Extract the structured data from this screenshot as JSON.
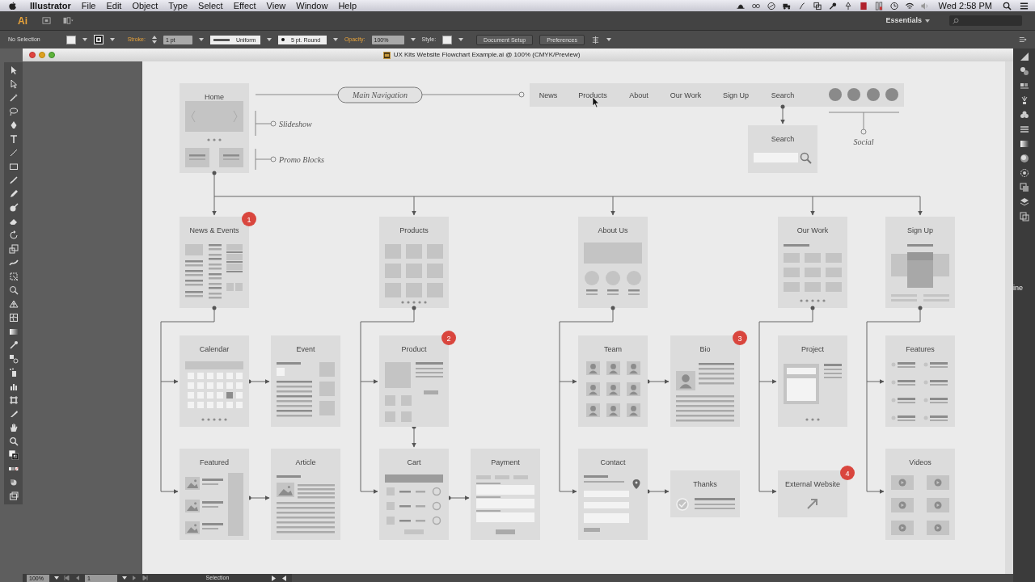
{
  "menu_bar": {
    "app_name": "Illustrator",
    "menus": [
      "File",
      "Edit",
      "Object",
      "Type",
      "Select",
      "Effect",
      "View",
      "Window",
      "Help"
    ],
    "clock": "Wed 2:58 PM"
  },
  "app_bar": {
    "logo": "Ai",
    "workspace": "Essentials"
  },
  "control_bar": {
    "selection": "No Selection",
    "stroke_label": "Stroke:",
    "stroke_weight": "1 pt",
    "profile": "Uniform",
    "brush": "5 pt. Round",
    "opacity_label": "Opacity:",
    "opacity": "100%",
    "style_label": "Style:",
    "buttons": [
      "Document Setup",
      "Preferences"
    ]
  },
  "document": {
    "title": "UX Kits Website Flowchart Example.ai @ 100% (CMYK/Preview)"
  },
  "flowchart": {
    "home": {
      "title": "Home",
      "kind": "home"
    },
    "main_navigation": "Main Navigation",
    "annotations": [
      "Slideshow",
      "Promo Blocks"
    ],
    "nav_items": [
      "News",
      "Products",
      "About",
      "Our Work",
      "Sign Up",
      "Search"
    ],
    "social_label": "Social",
    "search_page": {
      "title": "Search",
      "kind": "search"
    },
    "sections": [
      {
        "page": {
          "title": "News & Events",
          "kind": "article-list",
          "badge": "1"
        },
        "subpages": [
          {
            "title": "Calendar",
            "kind": "calendar"
          },
          {
            "title": "Event",
            "kind": "event"
          },
          {
            "title": "Featured",
            "kind": "media-list"
          },
          {
            "title": "Article",
            "kind": "article"
          }
        ]
      },
      {
        "page": {
          "title": "Products",
          "kind": "grid"
        },
        "subpages": [
          {
            "title": "Product",
            "kind": "product",
            "badge": "2"
          },
          {
            "title": "Cart",
            "kind": "cart"
          },
          {
            "title": "Payment",
            "kind": "form"
          }
        ]
      },
      {
        "page": {
          "title": "About Us",
          "kind": "about"
        },
        "subpages": [
          {
            "title": "Team",
            "kind": "team"
          },
          {
            "title": "Bio",
            "kind": "bio",
            "badge": "3"
          },
          {
            "title": "Contact",
            "kind": "contact"
          },
          {
            "title": "Thanks",
            "kind": "thanks"
          }
        ]
      },
      {
        "page": {
          "title": "Our Work",
          "kind": "portfolio"
        },
        "subpages": [
          {
            "title": "Project",
            "kind": "project"
          },
          {
            "title": "External Website",
            "kind": "external",
            "badge": "4"
          }
        ]
      },
      {
        "page": {
          "title": "Sign Up",
          "kind": "signup"
        },
        "subpages": [
          {
            "title": "Features",
            "kind": "features"
          },
          {
            "title": "Videos",
            "kind": "videos"
          }
        ]
      }
    ]
  },
  "desktop_text": "ine",
  "status_bar": {
    "zoom": "100%",
    "artboard": "1",
    "tool": "Selection"
  }
}
